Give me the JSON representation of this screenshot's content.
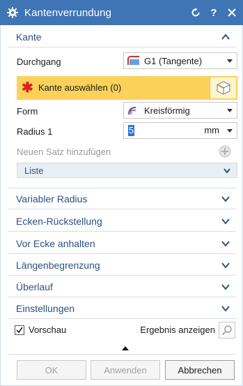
{
  "window": {
    "title": "Kantenverrundung",
    "reset_icon": "reset-icon",
    "help_label": "?",
    "close_icon": "close-icon"
  },
  "kante": {
    "header": "Kante",
    "durchgang_label": "Durchgang",
    "durchgang_value": "G1 (Tangente)",
    "select_label": "Kante auswählen (0)",
    "form_label": "Form",
    "form_value": "Kreisförmig",
    "radius_label": "Radius 1",
    "radius_value": "5",
    "radius_unit": "mm",
    "neuer_satz_label": "Neuen Satz hinzufügen",
    "liste_label": "Liste"
  },
  "sections": [
    "Variabler Radius",
    "Ecken-Rückstellung",
    "Vor Ecke anhalten",
    "Längenbegrenzung",
    "Überlauf",
    "Einstellungen"
  ],
  "footer": {
    "vorschau_label": "Vorschau",
    "vorschau_checked": true,
    "ergebnis_label": "Ergebnis anzeigen"
  },
  "buttons": {
    "ok": "OK",
    "anwenden": "Anwenden",
    "abbrechen": "Abbrechen"
  },
  "colors": {
    "titlebar": "#3f74b5",
    "section_text": "#2f4f7f",
    "required_bg": "#fad25a",
    "required_star": "#e02020"
  }
}
